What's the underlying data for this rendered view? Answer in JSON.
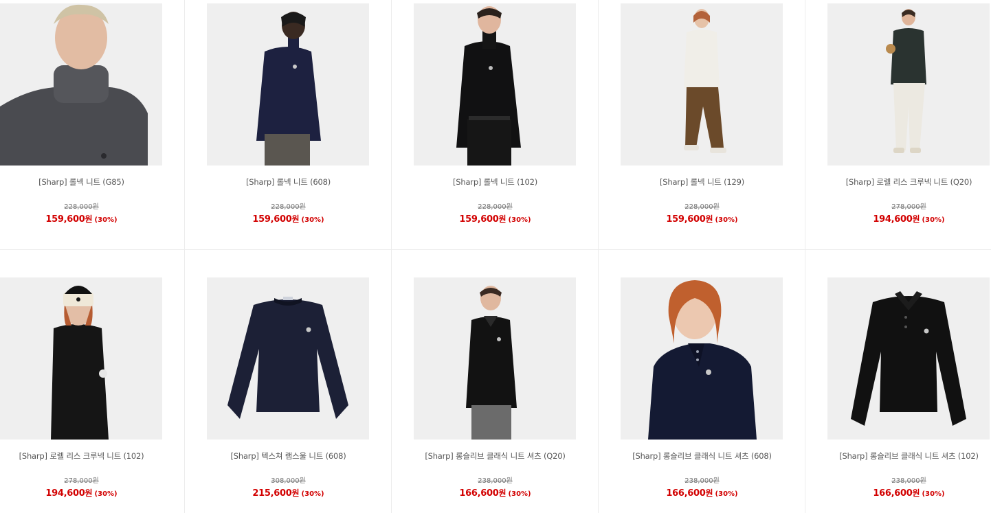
{
  "products": [
    {
      "name": "[Sharp] 롤넥 니트 (G85)",
      "original_price": "228,000원",
      "sale_price": "159,600",
      "currency": "원",
      "discount": "(30%)",
      "image": "model-gray-rollneck-closeup"
    },
    {
      "name": "[Sharp] 롤넥 니트 (608)",
      "original_price": "228,000원",
      "sale_price": "159,600",
      "currency": "원",
      "discount": "(30%)",
      "image": "model-navy-rollneck"
    },
    {
      "name": "[Sharp] 롤넥 니트 (102)",
      "original_price": "228,000원",
      "sale_price": "159,600",
      "currency": "원",
      "discount": "(30%)",
      "image": "model-black-rollneck"
    },
    {
      "name": "[Sharp] 롤넥 니트 (129)",
      "original_price": "228,000원",
      "sale_price": "159,600",
      "currency": "원",
      "discount": "(30%)",
      "image": "model-white-rollneck-fullbody"
    },
    {
      "name": "[Sharp] 로렐 리스 크루넥 니트 (Q20)",
      "original_price": "278,000원",
      "sale_price": "194,600",
      "currency": "원",
      "discount": "(30%)",
      "image": "model-green-crewneck-fullbody"
    },
    {
      "name": "[Sharp] 로렐 리스 크루넥 니트 (102)",
      "original_price": "278,000원",
      "sale_price": "194,600",
      "currency": "원",
      "discount": "(30%)",
      "image": "model-black-crewneck-beanie"
    },
    {
      "name": "[Sharp] 텍스쳐 램스울 니트 (608)",
      "original_price": "308,000원",
      "sale_price": "215,600",
      "currency": "원",
      "discount": "(30%)",
      "image": "navy-textured-sweater-flat"
    },
    {
      "name": "[Sharp] 롱슬리브 클래식 니트 셔츠 (Q20)",
      "original_price": "238,000원",
      "sale_price": "166,600",
      "currency": "원",
      "discount": "(30%)",
      "image": "model-black-knit-polo"
    },
    {
      "name": "[Sharp] 롱슬리브 클래식 니트 셔츠 (608)",
      "original_price": "238,000원",
      "sale_price": "166,600",
      "currency": "원",
      "discount": "(30%)",
      "image": "model-navy-knit-polo-redhair"
    },
    {
      "name": "[Sharp] 롱슬리브 클래식 니트 셔츠 (102)",
      "original_price": "238,000원",
      "sale_price": "166,600",
      "currency": "원",
      "discount": "(30%)",
      "image": "black-knit-polo-flat"
    }
  ],
  "colors": {
    "sale": "#d20000",
    "name": "#555555",
    "original": "#777777",
    "divider": "#ececec",
    "photo_bg": "#f2f2f2"
  }
}
